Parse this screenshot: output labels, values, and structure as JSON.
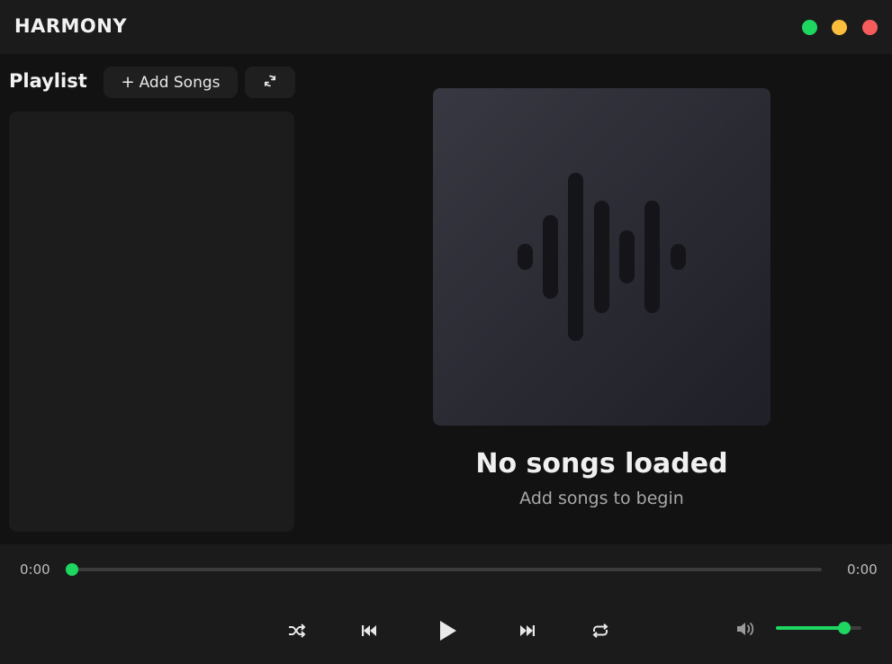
{
  "app": {
    "title": "HARMONY"
  },
  "window_controls": [
    {
      "name": "maximize",
      "color": "#1ed760"
    },
    {
      "name": "minimize",
      "color": "#fdbd3d"
    },
    {
      "name": "close",
      "color": "#f75c5c"
    }
  ],
  "playlist": {
    "title": "Playlist",
    "add_button": {
      "icon": "plus-icon",
      "label": "Add Songs"
    },
    "refresh_button": {
      "icon": "refresh-icon"
    },
    "items": []
  },
  "now_playing": {
    "art_icon": "sound-wave-icon",
    "title": "No songs loaded",
    "subtitle": "Add songs to begin"
  },
  "player": {
    "current_time": "0:00",
    "total_time": "0:00",
    "progress": 0,
    "controls": [
      "shuffle-icon",
      "previous-icon",
      "play-icon",
      "next-icon",
      "repeat-icon"
    ],
    "volume_icon": "volume-icon",
    "volume": 0.8
  },
  "colors": {
    "accent": "#1ed760",
    "background": "#121212",
    "panel": "#1b1b1b"
  }
}
